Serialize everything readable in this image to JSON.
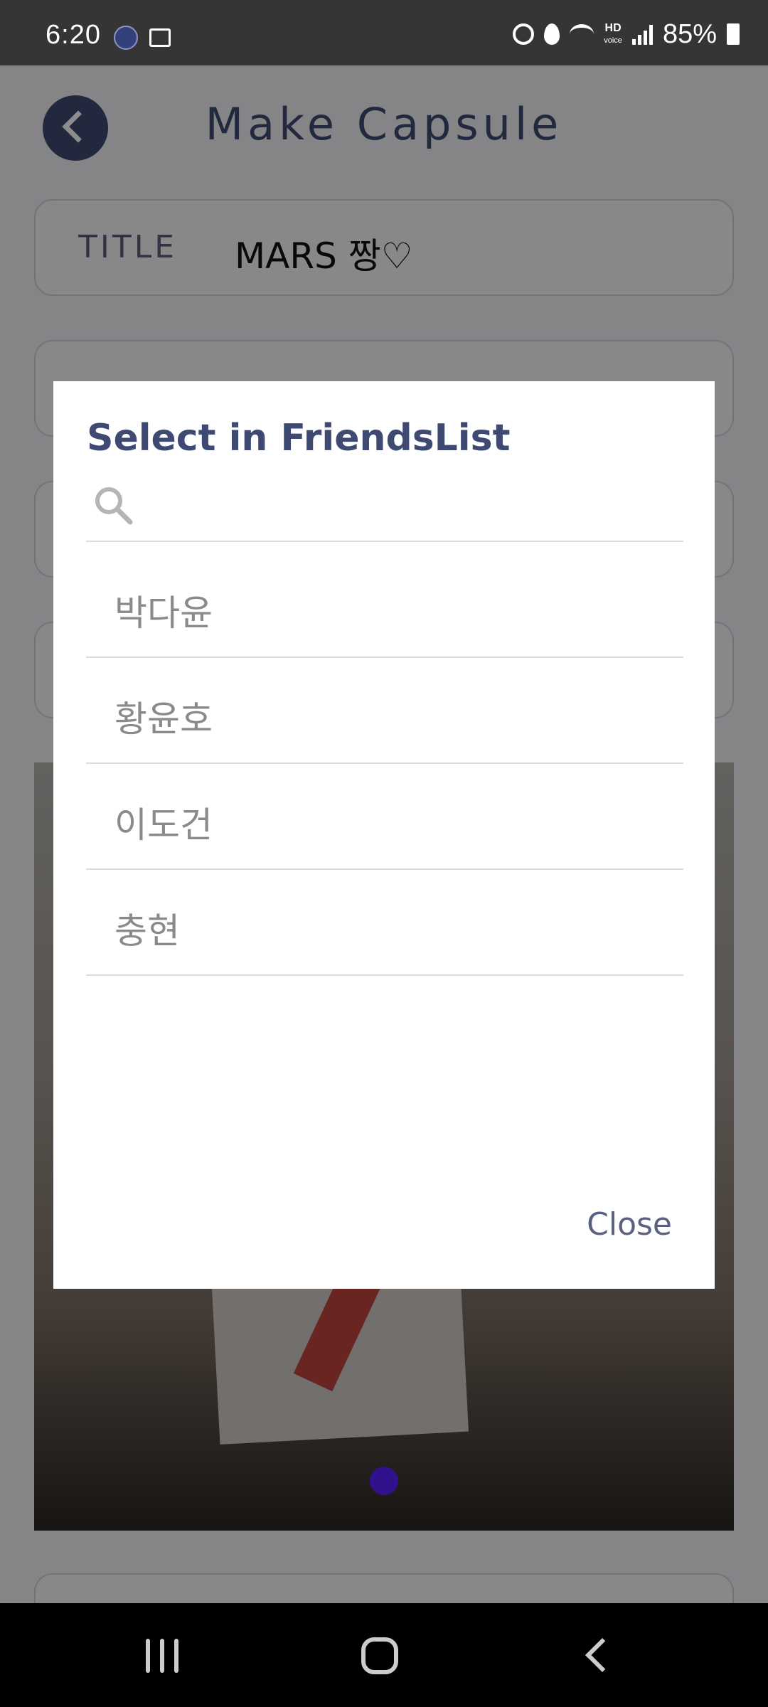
{
  "status_bar": {
    "time": "6:20",
    "battery": "85%",
    "hd_label": "HD",
    "voice_label": "voice"
  },
  "header": {
    "title": "Make Capsule"
  },
  "form": {
    "title_label": "TITLE",
    "title_value": "MARS 짱♡"
  },
  "dialog": {
    "title": "Select in FriendsList",
    "search_placeholder": "",
    "search_value": "",
    "friends": [
      "박다윤",
      "황윤호",
      "이도건",
      "충현"
    ],
    "close_label": "Close"
  },
  "colors": {
    "accent": "#3f4a72",
    "scrim": "rgba(0,0,0,0.45)",
    "dialog_bg": "#ffffff",
    "nav_bar": "#000000",
    "status_bar": "#353535"
  }
}
